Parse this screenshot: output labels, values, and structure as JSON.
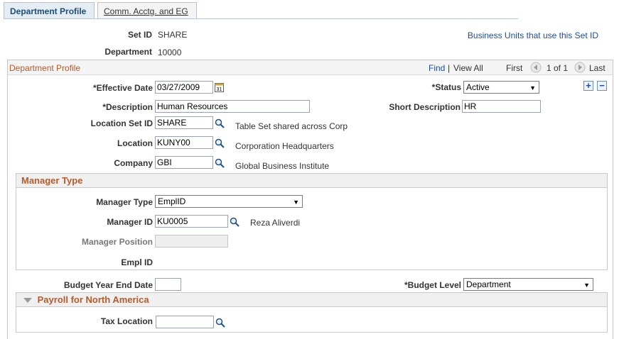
{
  "tabs": [
    {
      "label": "Department Profile"
    },
    {
      "label": "Comm. Acctg. and EG"
    }
  ],
  "header": {
    "setid_label": "Set ID",
    "setid_value": "SHARE",
    "department_label": "Department",
    "department_value": "10000",
    "bu_link": "Business Units that use this Set ID"
  },
  "profile": {
    "title": "Department Profile",
    "find": "Find",
    "separator": "|",
    "view_all": "View All",
    "first": "First",
    "count": "1 of 1",
    "last": "Last",
    "effdt_label": "*Effective Date",
    "effdt_value": "03/27/2009",
    "status_label": "*Status",
    "status_value": "Active",
    "descr_label": "*Description",
    "descr_value": "Human Resources",
    "short_descr_label": "Short Description",
    "short_descr_value": "HR",
    "location_setid_label": "Location Set ID",
    "location_setid_value": "SHARE",
    "location_setid_descr": "Table Set shared across Corp",
    "location_label": "Location",
    "location_value": "KUNY00",
    "location_descr": "Corporation Headquarters",
    "company_label": "Company",
    "company_value": "GBI",
    "company_descr": "Global Business Institute"
  },
  "manager": {
    "title": "Manager Type",
    "type_label": "Manager Type",
    "type_value": "EmplID",
    "id_label": "Manager ID",
    "id_value": "KU0005",
    "id_descr": "Reza Aliverdi",
    "position_label": "Manager Position",
    "position_value": "",
    "emplid_label": "Empl ID"
  },
  "budget": {
    "year_end_label": "Budget Year End Date",
    "year_end_value": "",
    "level_label": "*Budget Level",
    "level_value": "Department"
  },
  "payroll": {
    "title": "Payroll for North America",
    "tax_label": "Tax Location",
    "tax_value": ""
  },
  "icons": {
    "lookup": "magnifier-icon",
    "calendar": "calendar-icon",
    "add": "plus-icon",
    "delete": "minus-icon",
    "prev": "left-arrow-icon",
    "next": "right-arrow-icon",
    "collapse": "triangle-down-icon"
  },
  "colors": {
    "link": "#1c4ea0",
    "section_title": "#b55a2c",
    "tab_active_bg": "#e4ecf4"
  }
}
